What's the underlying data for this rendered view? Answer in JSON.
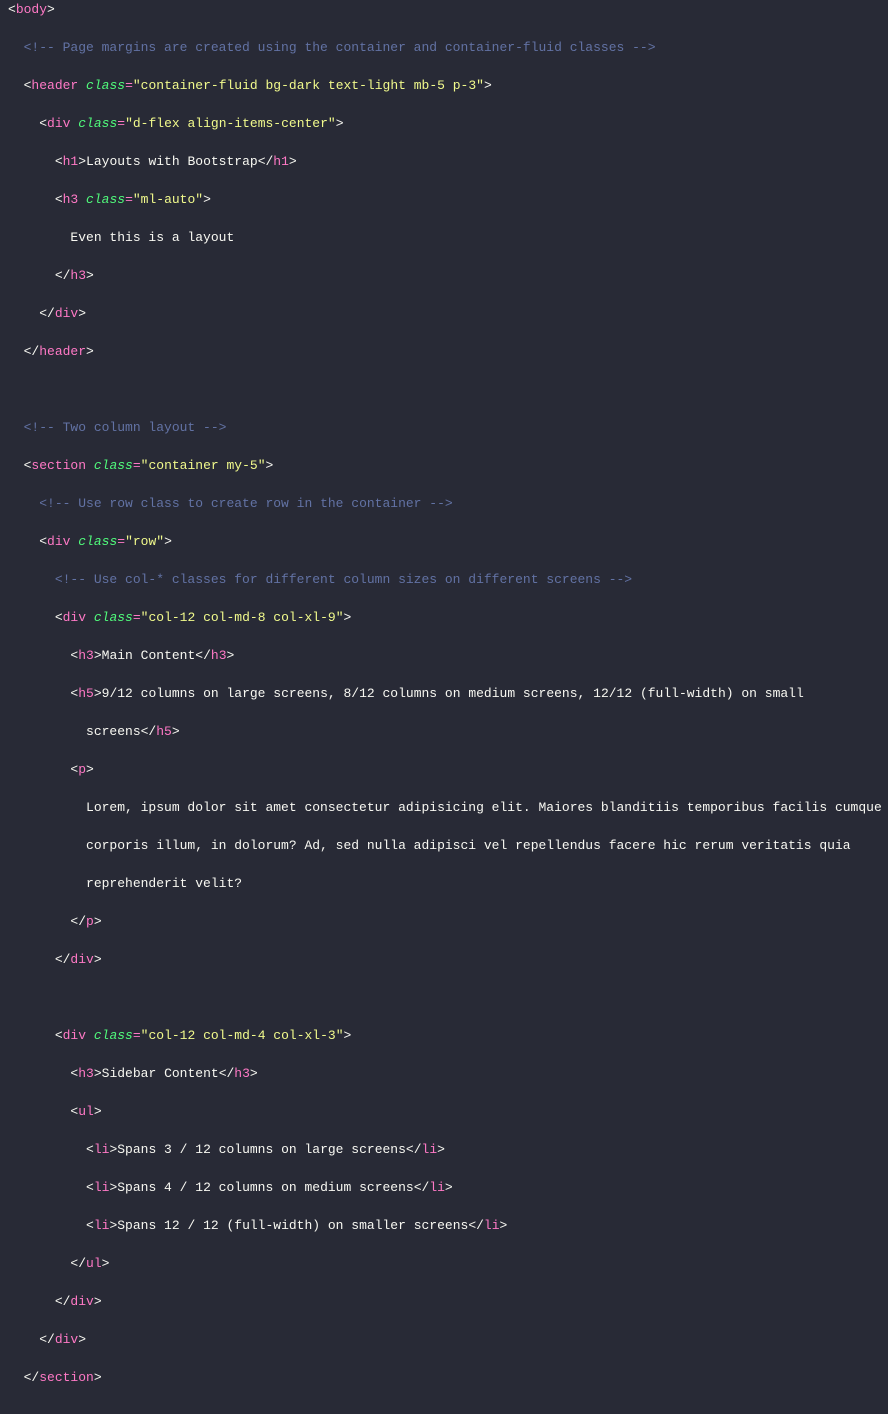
{
  "lines": [
    {
      "indent": 0,
      "tokens": [
        {
          "c": "t-bracket",
          "t": "<"
        },
        {
          "c": "t-tag",
          "t": "body"
        },
        {
          "c": "t-bracket",
          "t": ">"
        }
      ]
    },
    {
      "indent": 1,
      "tokens": [
        {
          "c": "t-comment",
          "t": "<!-- Page margins are created using the container and container-fluid classes -->"
        }
      ]
    },
    {
      "indent": 1,
      "tokens": [
        {
          "c": "t-bracket",
          "t": "<"
        },
        {
          "c": "t-tag",
          "t": "header"
        },
        {
          "c": "t-text",
          "t": " "
        },
        {
          "c": "t-attr",
          "t": "class"
        },
        {
          "c": "t-eq",
          "t": "="
        },
        {
          "c": "t-str",
          "t": "\"container-fluid bg-dark text-light mb-5 p-3\""
        },
        {
          "c": "t-bracket",
          "t": ">"
        }
      ]
    },
    {
      "indent": 2,
      "tokens": [
        {
          "c": "t-bracket",
          "t": "<"
        },
        {
          "c": "t-tag",
          "t": "div"
        },
        {
          "c": "t-text",
          "t": " "
        },
        {
          "c": "t-attr",
          "t": "class"
        },
        {
          "c": "t-eq",
          "t": "="
        },
        {
          "c": "t-str",
          "t": "\"d-flex align-items-center\""
        },
        {
          "c": "t-bracket",
          "t": ">"
        }
      ]
    },
    {
      "indent": 3,
      "tokens": [
        {
          "c": "t-bracket",
          "t": "<"
        },
        {
          "c": "t-tag",
          "t": "h1"
        },
        {
          "c": "t-bracket",
          "t": ">"
        },
        {
          "c": "t-text",
          "t": "Layouts with Bootstrap"
        },
        {
          "c": "t-bracket",
          "t": "</"
        },
        {
          "c": "t-tag",
          "t": "h1"
        },
        {
          "c": "t-bracket",
          "t": ">"
        }
      ]
    },
    {
      "indent": 3,
      "tokens": [
        {
          "c": "t-bracket",
          "t": "<"
        },
        {
          "c": "t-tag",
          "t": "h3"
        },
        {
          "c": "t-text",
          "t": " "
        },
        {
          "c": "t-attr",
          "t": "class"
        },
        {
          "c": "t-eq",
          "t": "="
        },
        {
          "c": "t-str",
          "t": "\"ml-auto\""
        },
        {
          "c": "t-bracket",
          "t": ">"
        }
      ]
    },
    {
      "indent": 4,
      "tokens": [
        {
          "c": "t-text",
          "t": "Even this is a layout"
        }
      ]
    },
    {
      "indent": 3,
      "tokens": [
        {
          "c": "t-bracket",
          "t": "</"
        },
        {
          "c": "t-tag",
          "t": "h3"
        },
        {
          "c": "t-bracket",
          "t": ">"
        }
      ]
    },
    {
      "indent": 2,
      "tokens": [
        {
          "c": "t-bracket",
          "t": "</"
        },
        {
          "c": "t-tag",
          "t": "div"
        },
        {
          "c": "t-bracket",
          "t": ">"
        }
      ]
    },
    {
      "indent": 1,
      "tokens": [
        {
          "c": "t-bracket",
          "t": "</"
        },
        {
          "c": "t-tag",
          "t": "header"
        },
        {
          "c": "t-bracket",
          "t": ">"
        }
      ]
    },
    {
      "indent": 0,
      "tokens": []
    },
    {
      "indent": 1,
      "tokens": [
        {
          "c": "t-comment",
          "t": "<!-- Two column layout -->"
        }
      ]
    },
    {
      "indent": 1,
      "tokens": [
        {
          "c": "t-bracket",
          "t": "<"
        },
        {
          "c": "t-tag",
          "t": "section"
        },
        {
          "c": "t-text",
          "t": " "
        },
        {
          "c": "t-attr",
          "t": "class"
        },
        {
          "c": "t-eq",
          "t": "="
        },
        {
          "c": "t-str",
          "t": "\"container my-5\""
        },
        {
          "c": "t-bracket",
          "t": ">"
        }
      ]
    },
    {
      "indent": 2,
      "tokens": [
        {
          "c": "t-comment",
          "t": "<!-- Use row class to create row in the container -->"
        }
      ]
    },
    {
      "indent": 2,
      "tokens": [
        {
          "c": "t-bracket",
          "t": "<"
        },
        {
          "c": "t-tag",
          "t": "div"
        },
        {
          "c": "t-text",
          "t": " "
        },
        {
          "c": "t-attr",
          "t": "class"
        },
        {
          "c": "t-eq",
          "t": "="
        },
        {
          "c": "t-str",
          "t": "\"row\""
        },
        {
          "c": "t-bracket",
          "t": ">"
        }
      ]
    },
    {
      "indent": 3,
      "tokens": [
        {
          "c": "t-comment",
          "t": "<!-- Use col-* classes for different column sizes on different screens -->"
        }
      ]
    },
    {
      "indent": 3,
      "tokens": [
        {
          "c": "t-bracket",
          "t": "<"
        },
        {
          "c": "t-tag",
          "t": "div"
        },
        {
          "c": "t-text",
          "t": " "
        },
        {
          "c": "t-attr",
          "t": "class"
        },
        {
          "c": "t-eq",
          "t": "="
        },
        {
          "c": "t-str",
          "t": "\"col-12 col-md-8 col-xl-9\""
        },
        {
          "c": "t-bracket",
          "t": ">"
        }
      ]
    },
    {
      "indent": 4,
      "tokens": [
        {
          "c": "t-bracket",
          "t": "<"
        },
        {
          "c": "t-tag",
          "t": "h3"
        },
        {
          "c": "t-bracket",
          "t": ">"
        },
        {
          "c": "t-text",
          "t": "Main Content"
        },
        {
          "c": "t-bracket",
          "t": "</"
        },
        {
          "c": "t-tag",
          "t": "h3"
        },
        {
          "c": "t-bracket",
          "t": ">"
        }
      ]
    },
    {
      "indent": 4,
      "tokens": [
        {
          "c": "t-bracket",
          "t": "<"
        },
        {
          "c": "t-tag",
          "t": "h5"
        },
        {
          "c": "t-bracket",
          "t": ">"
        },
        {
          "c": "t-text",
          "t": "9/12 columns on large screens, 8/12 columns on medium screens, 12/12 (full-width) on small "
        }
      ]
    },
    {
      "indent": 5,
      "tokens": [
        {
          "c": "t-text",
          "t": "screens"
        },
        {
          "c": "t-bracket",
          "t": "</"
        },
        {
          "c": "t-tag",
          "t": "h5"
        },
        {
          "c": "t-bracket",
          "t": ">"
        }
      ]
    },
    {
      "indent": 4,
      "tokens": [
        {
          "c": "t-bracket",
          "t": "<"
        },
        {
          "c": "t-tag",
          "t": "p"
        },
        {
          "c": "t-bracket",
          "t": ">"
        }
      ]
    },
    {
      "indent": 5,
      "tokens": [
        {
          "c": "t-text",
          "t": "Lorem, ipsum dolor sit amet consectetur adipisicing elit. Maiores blanditiis temporibus facilis cumque "
        }
      ]
    },
    {
      "indent": 5,
      "tokens": [
        {
          "c": "t-text",
          "t": "corporis illum, in dolorum? Ad, sed nulla adipisci vel repellendus facere hic rerum veritatis quia "
        }
      ]
    },
    {
      "indent": 5,
      "tokens": [
        {
          "c": "t-text",
          "t": "reprehenderit velit?"
        }
      ]
    },
    {
      "indent": 4,
      "tokens": [
        {
          "c": "t-bracket",
          "t": "</"
        },
        {
          "c": "t-tag",
          "t": "p"
        },
        {
          "c": "t-bracket",
          "t": ">"
        }
      ]
    },
    {
      "indent": 3,
      "tokens": [
        {
          "c": "t-bracket",
          "t": "</"
        },
        {
          "c": "t-tag",
          "t": "div"
        },
        {
          "c": "t-bracket",
          "t": ">"
        }
      ]
    },
    {
      "indent": 0,
      "tokens": []
    },
    {
      "indent": 3,
      "tokens": [
        {
          "c": "t-bracket",
          "t": "<"
        },
        {
          "c": "t-tag",
          "t": "div"
        },
        {
          "c": "t-text",
          "t": " "
        },
        {
          "c": "t-attr",
          "t": "class"
        },
        {
          "c": "t-eq",
          "t": "="
        },
        {
          "c": "t-str",
          "t": "\"col-12 col-md-4 col-xl-3\""
        },
        {
          "c": "t-bracket",
          "t": ">"
        }
      ]
    },
    {
      "indent": 4,
      "tokens": [
        {
          "c": "t-bracket",
          "t": "<"
        },
        {
          "c": "t-tag",
          "t": "h3"
        },
        {
          "c": "t-bracket",
          "t": ">"
        },
        {
          "c": "t-text",
          "t": "Sidebar Content"
        },
        {
          "c": "t-bracket",
          "t": "</"
        },
        {
          "c": "t-tag",
          "t": "h3"
        },
        {
          "c": "t-bracket",
          "t": ">"
        }
      ]
    },
    {
      "indent": 4,
      "tokens": [
        {
          "c": "t-bracket",
          "t": "<"
        },
        {
          "c": "t-tag",
          "t": "ul"
        },
        {
          "c": "t-bracket",
          "t": ">"
        }
      ]
    },
    {
      "indent": 5,
      "tokens": [
        {
          "c": "t-bracket",
          "t": "<"
        },
        {
          "c": "t-tag",
          "t": "li"
        },
        {
          "c": "t-bracket",
          "t": ">"
        },
        {
          "c": "t-text",
          "t": "Spans 3 / 12 columns on large screens"
        },
        {
          "c": "t-bracket",
          "t": "</"
        },
        {
          "c": "t-tag",
          "t": "li"
        },
        {
          "c": "t-bracket",
          "t": ">"
        }
      ]
    },
    {
      "indent": 5,
      "tokens": [
        {
          "c": "t-bracket",
          "t": "<"
        },
        {
          "c": "t-tag",
          "t": "li"
        },
        {
          "c": "t-bracket",
          "t": ">"
        },
        {
          "c": "t-text",
          "t": "Spans 4 / 12 columns on medium screens"
        },
        {
          "c": "t-bracket",
          "t": "</"
        },
        {
          "c": "t-tag",
          "t": "li"
        },
        {
          "c": "t-bracket",
          "t": ">"
        }
      ]
    },
    {
      "indent": 5,
      "tokens": [
        {
          "c": "t-bracket",
          "t": "<"
        },
        {
          "c": "t-tag",
          "t": "li"
        },
        {
          "c": "t-bracket",
          "t": ">"
        },
        {
          "c": "t-text",
          "t": "Spans 12 / 12 (full-width) on smaller screens"
        },
        {
          "c": "t-bracket",
          "t": "</"
        },
        {
          "c": "t-tag",
          "t": "li"
        },
        {
          "c": "t-bracket",
          "t": ">"
        }
      ]
    },
    {
      "indent": 4,
      "tokens": [
        {
          "c": "t-bracket",
          "t": "</"
        },
        {
          "c": "t-tag",
          "t": "ul"
        },
        {
          "c": "t-bracket",
          "t": ">"
        }
      ]
    },
    {
      "indent": 3,
      "tokens": [
        {
          "c": "t-bracket",
          "t": "</"
        },
        {
          "c": "t-tag",
          "t": "div"
        },
        {
          "c": "t-bracket",
          "t": ">"
        }
      ]
    },
    {
      "indent": 2,
      "tokens": [
        {
          "c": "t-bracket",
          "t": "</"
        },
        {
          "c": "t-tag",
          "t": "div"
        },
        {
          "c": "t-bracket",
          "t": ">"
        }
      ]
    },
    {
      "indent": 1,
      "tokens": [
        {
          "c": "t-bracket",
          "t": "</"
        },
        {
          "c": "t-tag",
          "t": "section"
        },
        {
          "c": "t-bracket",
          "t": ">"
        }
      ]
    }
  ]
}
